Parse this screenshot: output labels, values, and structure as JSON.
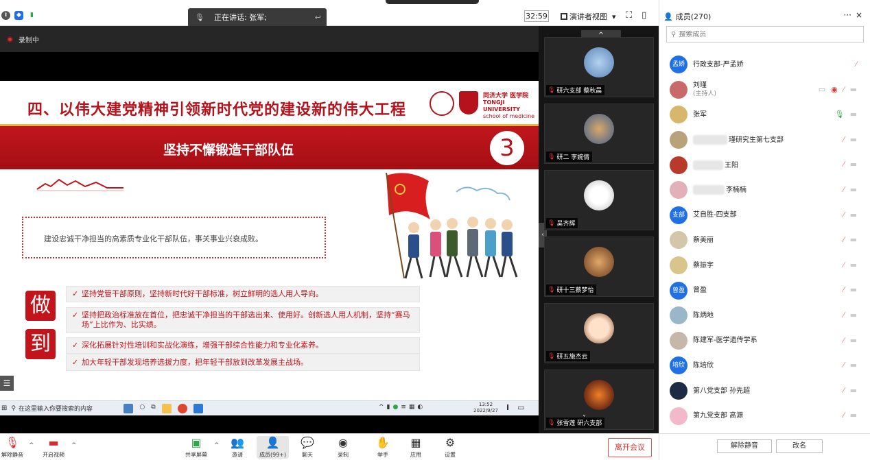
{
  "topbar": {
    "speaker_label": "正在讲话: 张军;",
    "timer": "32:59",
    "view_label": "演讲者视图",
    "view_caret": "▾"
  },
  "stage": {
    "recording_label": "录制中",
    "slide": {
      "title": "四、以伟大建党精神引领新时代党的建设新的伟大工程",
      "logo_cn": "同济大学 医学院",
      "logo_en1": "TONGJI UNIVERSITY",
      "logo_en2": "school of medicine",
      "band_text": "坚持不懈锻造干部队伍",
      "band_number": "3",
      "intro": "建设忠诚干净担当的高素质专业化干部队伍，事关事业兴衰成败。",
      "side_char_1": "做",
      "side_char_2": "到",
      "points": [
        "坚持党管干部原则，坚持新时代好干部标准，树立鲜明的选人用人导向。",
        "坚持把政治标准放在首位，把忠诚干净担当的干部选出来、使用好。创新选人用人机制，坚持“赛马场”上比作为、比实绩。",
        "深化拓展针对性培训和实战化演练，增强干部综合性能力和专业化素养。",
        "加大年轻干部发现培养选拔力度，把年轻干部放到改革发展主战场。"
      ]
    },
    "taskbar": {
      "search_text": "在这里输入你要搜索的内容",
      "time": "13:52",
      "date": "2022/9/27"
    }
  },
  "strip": {
    "tiles": [
      {
        "name": "研六支部 蔡秋晨",
        "avatar_color": "#6b9bd1"
      },
      {
        "name": "研二 李婉倩",
        "avatar_color": "#8a6a4e"
      },
      {
        "name": "吴齐辉",
        "avatar_color": "#e8e8e8"
      },
      {
        "name": "研十三蔡梦怡",
        "avatar_color": "#a66a3e"
      },
      {
        "name": "研五施杰云",
        "avatar_color": "#ffffff"
      },
      {
        "name": "张雪莲 研六支部",
        "avatar_color": "#c0321a"
      }
    ]
  },
  "panel": {
    "title": "成员(270)",
    "more": "···",
    "close": "×",
    "search_placeholder": "搜索成员",
    "members": [
      {
        "avatar_text": "孟娇",
        "avatar_color": "#1f6fe5",
        "name": "行政支部-严孟娇",
        "sub": "",
        "blur_w": 0
      },
      {
        "avatar_text": "",
        "avatar_color": "#c96a6a",
        "name": "刘瑾",
        "sub": "(主持人)",
        "blur_w": 0
      },
      {
        "avatar_text": "",
        "avatar_color": "#d7b86a",
        "name": "张军",
        "sub": "",
        "blur_w": 0
      },
      {
        "avatar_text": "",
        "avatar_color": "#b9a27a",
        "name": "瑾研究生第七支部",
        "sub": "",
        "blur_w": 50
      },
      {
        "avatar_text": "",
        "avatar_color": "#b73a2a",
        "name": "王阳",
        "sub": "",
        "blur_w": 44
      },
      {
        "avatar_text": "",
        "avatar_color": "#e2b0b8",
        "name": "李楠楠",
        "sub": "",
        "blur_w": 46
      },
      {
        "avatar_text": "支部",
        "avatar_color": "#1f6fe5",
        "name": "艾自胜-四支部",
        "sub": "",
        "blur_w": 0
      },
      {
        "avatar_text": "",
        "avatar_color": "#d4c6a8",
        "name": "蔡美丽",
        "sub": "",
        "blur_w": 0
      },
      {
        "avatar_text": "",
        "avatar_color": "#d9c48a",
        "name": "蔡振宇",
        "sub": "",
        "blur_w": 0
      },
      {
        "avatar_text": "曾盈",
        "avatar_color": "#1f6fe5",
        "name": "曾盈",
        "sub": "",
        "blur_w": 0
      },
      {
        "avatar_text": "",
        "avatar_color": "#9ab7c9",
        "name": "陈炳地",
        "sub": "",
        "blur_w": 0
      },
      {
        "avatar_text": "",
        "avatar_color": "#c7b7a9",
        "name": "陈建军-医学遗传学系",
        "sub": "",
        "blur_w": 0
      },
      {
        "avatar_text": "培欣",
        "avatar_color": "#1f6fe5",
        "name": "陈培欣",
        "sub": "",
        "blur_w": 0
      },
      {
        "avatar_text": "",
        "avatar_color": "#1c2a44",
        "name": "第八党支部 孙先超",
        "sub": "",
        "blur_w": 0
      },
      {
        "avatar_text": "",
        "avatar_color": "#f1b9c9",
        "name": "第九党支部 高源",
        "sub": "",
        "blur_w": 0
      }
    ],
    "unmute_all": "解除静音",
    "rename": "改名"
  },
  "toolbar": {
    "unmute": "解除静音",
    "start_video": "开启视频",
    "share": "共享屏幕",
    "invite": "邀请",
    "members": "成员(99+)",
    "chat": "聊天",
    "record": "录制",
    "raise_hand": "举手",
    "apps": "应用",
    "settings": "设置",
    "leave": "离开会议"
  },
  "colors": {
    "brand_red": "#b5121b",
    "accent_blue": "#1f6fe5",
    "leave_red": "#d32f2f"
  }
}
